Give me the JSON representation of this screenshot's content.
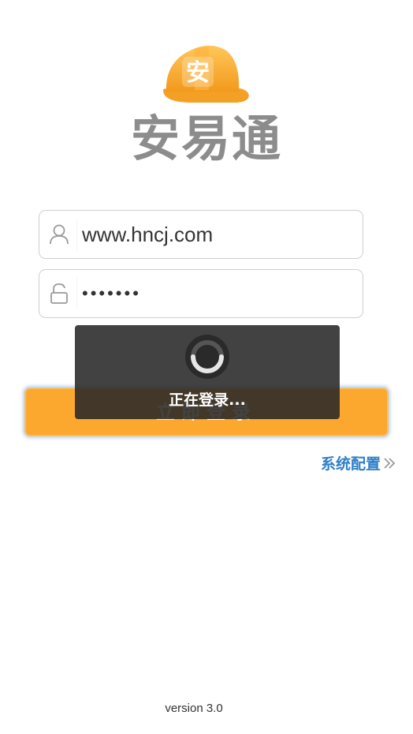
{
  "logo": {
    "helmet_text": "安",
    "app_name": "安易通",
    "helmet_color": "#f5a623"
  },
  "form": {
    "username": {
      "value": "www.hncj.com",
      "icon": "user-icon"
    },
    "password": {
      "value": "•••••••",
      "icon": "lock-icon"
    },
    "login_label": "立即登录"
  },
  "config_link": {
    "label": "系统配置",
    "icon": "double-chevron-right-icon"
  },
  "loading": {
    "message": "正在登录...",
    "icon": "spinner-icon"
  },
  "footer": {
    "version": "version 3.0"
  },
  "colors": {
    "accent": "#fca72d",
    "link": "#2f80c8",
    "title_gray": "#8c8c8c"
  }
}
